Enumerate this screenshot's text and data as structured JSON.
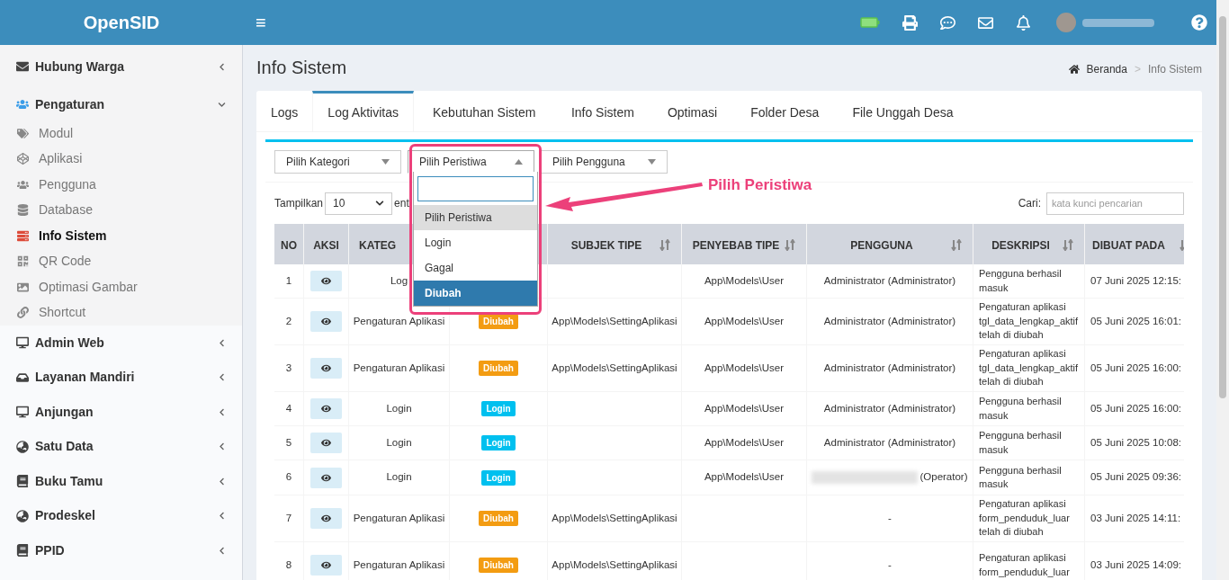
{
  "brand": "OpenSID",
  "topbar": {
    "menu_glyph": "≡"
  },
  "sidebar": [
    {
      "label": "Hubung Warga",
      "expanded": false
    },
    {
      "label": "Pengaturan",
      "expanded": true,
      "children": [
        {
          "label": "Modul",
          "selected": false
        },
        {
          "label": "Aplikasi",
          "selected": false
        },
        {
          "label": "Pengguna",
          "selected": false
        },
        {
          "label": "Database",
          "selected": false
        },
        {
          "label": "Info Sistem",
          "selected": true
        },
        {
          "label": "QR Code",
          "selected": false
        },
        {
          "label": "Optimasi Gambar",
          "selected": false
        },
        {
          "label": "Shortcut",
          "selected": false
        }
      ]
    },
    {
      "label": "Admin Web",
      "expanded": false
    },
    {
      "label": "Layanan Mandiri",
      "expanded": false
    },
    {
      "label": "Anjungan",
      "expanded": false
    },
    {
      "label": "Satu Data",
      "expanded": false
    },
    {
      "label": "Buku Tamu",
      "expanded": false
    },
    {
      "label": "Prodeskel",
      "expanded": false
    },
    {
      "label": "PPID",
      "expanded": false
    }
  ],
  "page_title": "Info Sistem",
  "breadcrumb": [
    "Beranda",
    "Info Sistem"
  ],
  "breadcrumb_separator": ">",
  "tabs": [
    {
      "label": "Logs",
      "selected": false
    },
    {
      "label": "Log Aktivitas",
      "selected": true
    },
    {
      "label": "Kebutuhan Sistem",
      "selected": false
    },
    {
      "label": "Info Sistem",
      "selected": false
    },
    {
      "label": "Optimasi",
      "selected": false
    },
    {
      "label": "Folder Desa",
      "selected": false
    },
    {
      "label": "File Unggah Desa",
      "selected": false
    }
  ],
  "filters": [
    {
      "value": "Pilih Kategori",
      "expanded": false
    },
    {
      "value": "Pilih Peristiwa",
      "expanded": true
    },
    {
      "value": "Pilih Pengguna",
      "expanded": false
    }
  ],
  "dropdown": {
    "options": [
      {
        "label": "Pilih Peristiwa",
        "selected": false,
        "hovered": true
      },
      {
        "label": "Login",
        "selected": false,
        "hovered": false
      },
      {
        "label": "Gagal",
        "selected": false,
        "hovered": false
      },
      {
        "label": "Diubah",
        "selected": true,
        "hovered": false
      }
    ]
  },
  "annotation": {
    "label": "Pilih Peristiwa"
  },
  "length": {
    "label": "Tampilkan",
    "value": "10",
    "after": "ent"
  },
  "search": {
    "label": "Cari:",
    "placeholder": "kata kunci pencarian"
  },
  "table": {
    "columns": [
      {
        "label": "NO",
        "sortable": false
      },
      {
        "label": "AKSI",
        "sortable": false
      },
      {
        "label": "KATEG"
      },
      {
        "label": "SUBJEK TIPE",
        "sortable": true
      },
      {
        "label": "PENYEBAB TIPE",
        "sortable": true
      },
      {
        "label": "PENGGUNA",
        "sortable": true
      },
      {
        "label": "DESKRIPSI",
        "sortable": true
      },
      {
        "label": "DIBUAT PADA",
        "sortable": true
      }
    ],
    "rows": [
      {
        "no": "1",
        "kategori": "Log",
        "event": null,
        "subjek": "",
        "penyebab": "App\\Models\\User",
        "pengguna": "Administrator (Administrator)",
        "redacted": false,
        "deskripsi": "Pengguna berhasil masuk",
        "dibuat": "07 Juni 2025 12:15:"
      },
      {
        "no": "2",
        "kategori": "Pengaturan Aplikasi",
        "event": {
          "label": "Diubah",
          "kind": "changed"
        },
        "subjek": "App\\Models\\SettingAplikasi",
        "penyebab": "App\\Models\\User",
        "pengguna": "Administrator (Administrator)",
        "redacted": false,
        "deskripsi": "Pengaturan aplikasi tgl_data_lengkap_aktif telah di diubah",
        "dibuat": "05 Juni 2025 16:01:"
      },
      {
        "no": "3",
        "kategori": "Pengaturan Aplikasi",
        "event": {
          "label": "Diubah",
          "kind": "changed"
        },
        "subjek": "App\\Models\\SettingAplikasi",
        "penyebab": "App\\Models\\User",
        "pengguna": "Administrator (Administrator)",
        "redacted": false,
        "deskripsi": "Pengaturan aplikasi tgl_data_lengkap_aktif telah di diubah",
        "dibuat": "05 Juni 2025 16:00:"
      },
      {
        "no": "4",
        "kategori": "Login",
        "event": {
          "label": "Login",
          "kind": "login"
        },
        "subjek": "",
        "penyebab": "App\\Models\\User",
        "pengguna": "Administrator (Administrator)",
        "redacted": false,
        "deskripsi": "Pengguna berhasil masuk",
        "dibuat": "05 Juni 2025 16:00:"
      },
      {
        "no": "5",
        "kategori": "Login",
        "event": {
          "label": "Login",
          "kind": "login"
        },
        "subjek": "",
        "penyebab": "App\\Models\\User",
        "pengguna": "Administrator (Administrator)",
        "redacted": false,
        "deskripsi": "Pengguna berhasil masuk",
        "dibuat": "05 Juni 2025 10:08:"
      },
      {
        "no": "6",
        "kategori": "Login",
        "event": {
          "label": "Login",
          "kind": "login"
        },
        "subjek": "",
        "penyebab": "App\\Models\\User",
        "pengguna": "(Operator)",
        "redacted": true,
        "deskripsi": "Pengguna berhasil masuk",
        "dibuat": "05 Juni 2025 09:36:"
      },
      {
        "no": "7",
        "kategori": "Pengaturan Aplikasi",
        "event": {
          "label": "Diubah",
          "kind": "changed"
        },
        "subjek": "App\\Models\\SettingAplikasi",
        "penyebab": "",
        "pengguna": "-",
        "redacted": false,
        "deskripsi": "Pengaturan aplikasi form_penduduk_luar telah di diubah",
        "dibuat": "03 Juni 2025 14:11:"
      },
      {
        "no": "8",
        "kategori": "Pengaturan Aplikasi",
        "event": {
          "label": "Diubah",
          "kind": "changed"
        },
        "subjek": "App\\Models\\SettingAplikasi",
        "penyebab": "",
        "pengguna": "-",
        "redacted": false,
        "deskripsi": "Pengaturan aplikasi form_penduduk_luar",
        "dibuat": "03 Juni 2025 14:09:"
      }
    ]
  }
}
